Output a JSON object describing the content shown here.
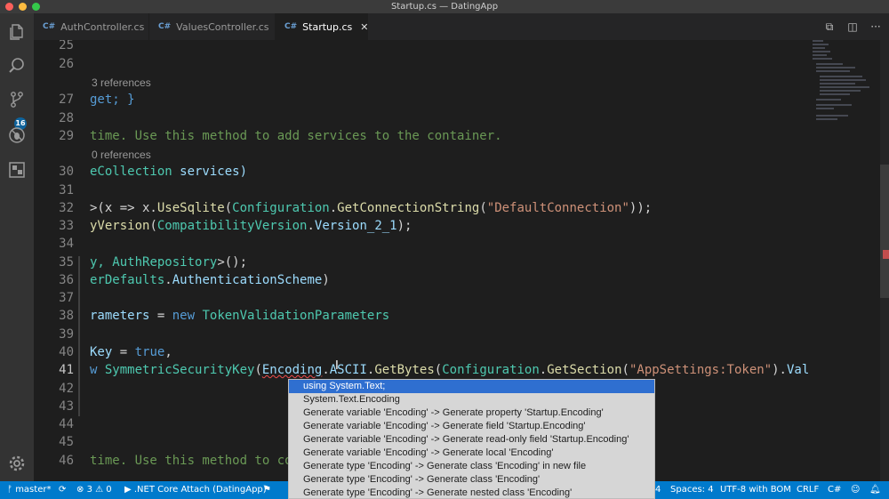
{
  "window": {
    "title": "Startup.cs — DatingApp"
  },
  "activity_bar": {
    "scm_badge": "16"
  },
  "tabs": [
    {
      "icon": "C#",
      "label": "AuthController.cs"
    },
    {
      "icon": "C#",
      "label": "ValuesController.cs"
    },
    {
      "icon": "C#",
      "label": "Startup.cs",
      "close": "✕"
    }
  ],
  "editor": {
    "line_numbers": [
      "25",
      "26",
      "27",
      "28",
      "29",
      "30",
      "31",
      "32",
      "33",
      "34",
      "35",
      "36",
      "37",
      "38",
      "39",
      "40",
      "41",
      "42",
      "43",
      "44",
      "45",
      "46"
    ],
    "lens_refs": [
      "3 references",
      "0 references"
    ],
    "lines": {
      "l27": [
        "get; }"
      ],
      "l29": [
        "time. Use this method to add services to the container."
      ],
      "l30": [
        "eCollection",
        " services)"
      ],
      "l32": [
        ">(x => x.",
        "UseSqlite",
        "(",
        "Configuration",
        ".",
        "GetConnectionString",
        "(",
        "\"DefaultConnection\"",
        "));"
      ],
      "l33": [
        "yVersion",
        "(",
        "CompatibilityVersion",
        ".",
        "Version_2_1",
        ");"
      ],
      "l35": [
        "y, ",
        "AuthRepository",
        ">();"
      ],
      "l36": [
        "erDefaults",
        ".",
        "AuthenticationScheme",
        ")"
      ],
      "l38": [
        "rameters",
        " = ",
        "new",
        " ",
        "TokenValidationParameters"
      ],
      "l40": [
        "Key",
        " = ",
        "true",
        ","
      ],
      "l41": [
        "w ",
        "SymmetricSecurityKey",
        "(",
        "Encoding",
        ".",
        "ASCII",
        ".",
        "GetBytes",
        "(",
        "Configuration",
        ".",
        "GetSection",
        "(",
        "\"AppSettings:Token\"",
        ").",
        "Value",
        ")),"
      ],
      "l46": [
        "time. Use this method to con"
      ]
    }
  },
  "quick_fix": {
    "items": [
      "using System.Text;",
      "System.Text.Encoding",
      "Generate variable 'Encoding' -> Generate property 'Startup.Encoding'",
      "Generate variable 'Encoding' -> Generate field 'Startup.Encoding'",
      "Generate variable 'Encoding' -> Generate read-only field 'Startup.Encoding'",
      "Generate variable 'Encoding' -> Generate local 'Encoding'",
      "Generate type 'Encoding' -> Generate class 'Encoding' in new file",
      "Generate type 'Encoding' -> Generate class 'Encoding'",
      "Generate type 'Encoding' -> Generate nested class 'Encoding'"
    ],
    "selected_index": 0
  },
  "status_bar": {
    "branch": "master*",
    "errors": "3",
    "warnings": "0",
    "debug_target": ".NET Core Attach (DatingApp)",
    "position_fragment": "4",
    "spaces": "Spaces: 4",
    "encoding": "UTF-8 with BOM",
    "eol": "CRLF",
    "language": "C#"
  },
  "colors": {
    "status_bar": "#007acc",
    "type": "#4ec9b0",
    "string": "#ce9178",
    "keyword": "#569cd6",
    "comment": "#6a9955",
    "function": "#dcdcaa",
    "selection": "#2f6fd0"
  }
}
